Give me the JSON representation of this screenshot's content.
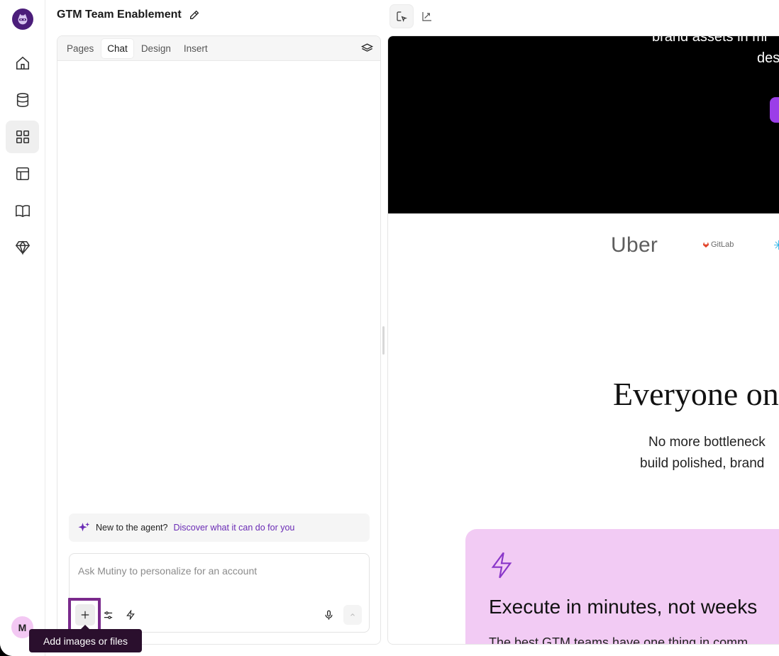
{
  "header": {
    "title": "GTM Team Enablement",
    "edit_icon": "pencil-icon"
  },
  "sidebar": {
    "logo": "raccoon-logo",
    "items": [
      {
        "icon": "home-icon"
      },
      {
        "icon": "database-icon"
      },
      {
        "icon": "grid-icon",
        "active": true
      },
      {
        "icon": "layout-icon"
      },
      {
        "icon": "book-icon"
      },
      {
        "icon": "gem-icon"
      }
    ],
    "avatar_initial": "M"
  },
  "panel": {
    "tabs": [
      "Pages",
      "Chat",
      "Design",
      "Insert"
    ],
    "active_tab": "Chat",
    "hint_text": "New to the agent?",
    "hint_link": "Discover what it can do for you",
    "input_placeholder": "Ask Mutiny to personalize for an account",
    "tooltip": "Add images or files"
  },
  "preview": {
    "hero_line1": "brand assets in mi",
    "hero_line2": "des",
    "logos": [
      "Uber",
      "GitLab"
    ],
    "headline": "Everyone on y",
    "sub1": "No more bottleneck",
    "sub2": "build polished, brand",
    "card_title": "Execute in minutes, not weeks",
    "card_body": "The best GTM teams have one thing in comm"
  },
  "colors": {
    "accent": "#6a2bb5",
    "focus_ring": "#7a2a8c",
    "card_bg": "#f2cbf4",
    "tooltip_bg": "#2a0f2d"
  }
}
